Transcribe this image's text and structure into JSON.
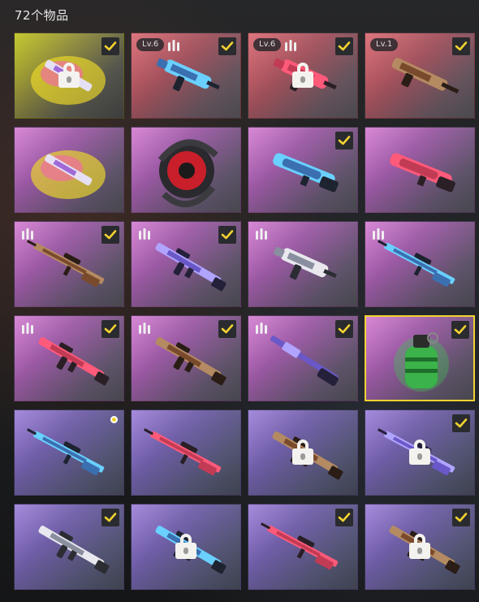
{
  "header": {
    "item_count": "72个物品"
  },
  "colors": {
    "check_yellow": "#f2d231",
    "lock_white": "#f4f2ee",
    "selected_border": "#f2d231"
  },
  "items": [
    {
      "rarity": "gold",
      "icon": "paint-spray-icon",
      "level": "",
      "ammo": false,
      "checked": true,
      "locked": true,
      "selected": false,
      "new": false
    },
    {
      "rarity": "red",
      "icon": "smg-icon",
      "level": "Lv.6",
      "ammo": true,
      "checked": true,
      "locked": false,
      "selected": false,
      "new": false
    },
    {
      "rarity": "red",
      "icon": "smg-icon",
      "level": "Lv.6",
      "ammo": true,
      "checked": true,
      "locked": true,
      "selected": false,
      "new": false
    },
    {
      "rarity": "red",
      "icon": "bullpup-rifle-icon",
      "level": "Lv.1",
      "ammo": false,
      "checked": true,
      "locked": false,
      "selected": false,
      "new": false
    },
    {
      "rarity": "pink",
      "icon": "paint-spray-icon",
      "level": "",
      "ammo": false,
      "checked": false,
      "locked": false,
      "selected": false,
      "new": false
    },
    {
      "rarity": "pink",
      "icon": "emblem-icon",
      "level": "",
      "ammo": false,
      "checked": false,
      "locked": false,
      "selected": false,
      "new": false
    },
    {
      "rarity": "pink",
      "icon": "shotgun-icon",
      "level": "",
      "ammo": false,
      "checked": true,
      "locked": false,
      "selected": false,
      "new": false
    },
    {
      "rarity": "pink",
      "icon": "shotgun-icon",
      "level": "",
      "ammo": false,
      "checked": false,
      "locked": false,
      "selected": false,
      "new": false
    },
    {
      "rarity": "pink",
      "icon": "sniper-rifle-icon",
      "level": "",
      "ammo": true,
      "checked": true,
      "locked": false,
      "selected": false,
      "new": false
    },
    {
      "rarity": "pink",
      "icon": "assault-rifle-icon",
      "level": "",
      "ammo": true,
      "checked": true,
      "locked": false,
      "selected": false,
      "new": false
    },
    {
      "rarity": "pink",
      "icon": "smg-icon",
      "level": "",
      "ammo": true,
      "checked": false,
      "locked": false,
      "selected": false,
      "new": false
    },
    {
      "rarity": "pink",
      "icon": "sniper-rifle-icon",
      "level": "",
      "ammo": true,
      "checked": false,
      "locked": false,
      "selected": false,
      "new": false
    },
    {
      "rarity": "pink",
      "icon": "assault-rifle-icon",
      "level": "",
      "ammo": true,
      "checked": true,
      "locked": false,
      "selected": false,
      "new": false
    },
    {
      "rarity": "pink",
      "icon": "assault-rifle-icon",
      "level": "",
      "ammo": true,
      "checked": true,
      "locked": false,
      "selected": false,
      "new": false
    },
    {
      "rarity": "pink",
      "icon": "pump-shotgun-icon",
      "level": "",
      "ammo": true,
      "checked": true,
      "locked": false,
      "selected": false,
      "new": false
    },
    {
      "rarity": "pink",
      "icon": "grenade-icon",
      "level": "",
      "ammo": false,
      "checked": true,
      "locked": false,
      "selected": true,
      "new": false
    },
    {
      "rarity": "purple",
      "icon": "rifle-icon",
      "level": "",
      "ammo": false,
      "checked": false,
      "locked": false,
      "selected": false,
      "new": true
    },
    {
      "rarity": "purple",
      "icon": "rifle-icon",
      "level": "",
      "ammo": false,
      "checked": false,
      "locked": false,
      "selected": false,
      "new": false
    },
    {
      "rarity": "purple",
      "icon": "assault-rifle-icon",
      "level": "",
      "ammo": false,
      "checked": false,
      "locked": true,
      "selected": false,
      "new": false
    },
    {
      "rarity": "purple",
      "icon": "rifle-icon",
      "level": "",
      "ammo": false,
      "checked": true,
      "locked": true,
      "selected": false,
      "new": false
    },
    {
      "rarity": "purple",
      "icon": "assault-rifle-icon",
      "level": "",
      "ammo": false,
      "checked": true,
      "locked": false,
      "selected": false,
      "new": false
    },
    {
      "rarity": "purple",
      "icon": "assault-rifle-icon",
      "level": "",
      "ammo": false,
      "checked": false,
      "locked": true,
      "selected": false,
      "new": false
    },
    {
      "rarity": "purple",
      "icon": "sniper-rifle-icon",
      "level": "",
      "ammo": false,
      "checked": true,
      "locked": false,
      "selected": false,
      "new": false
    },
    {
      "rarity": "purple",
      "icon": "assault-rifle-icon",
      "level": "",
      "ammo": false,
      "checked": true,
      "locked": true,
      "selected": false,
      "new": false
    }
  ]
}
